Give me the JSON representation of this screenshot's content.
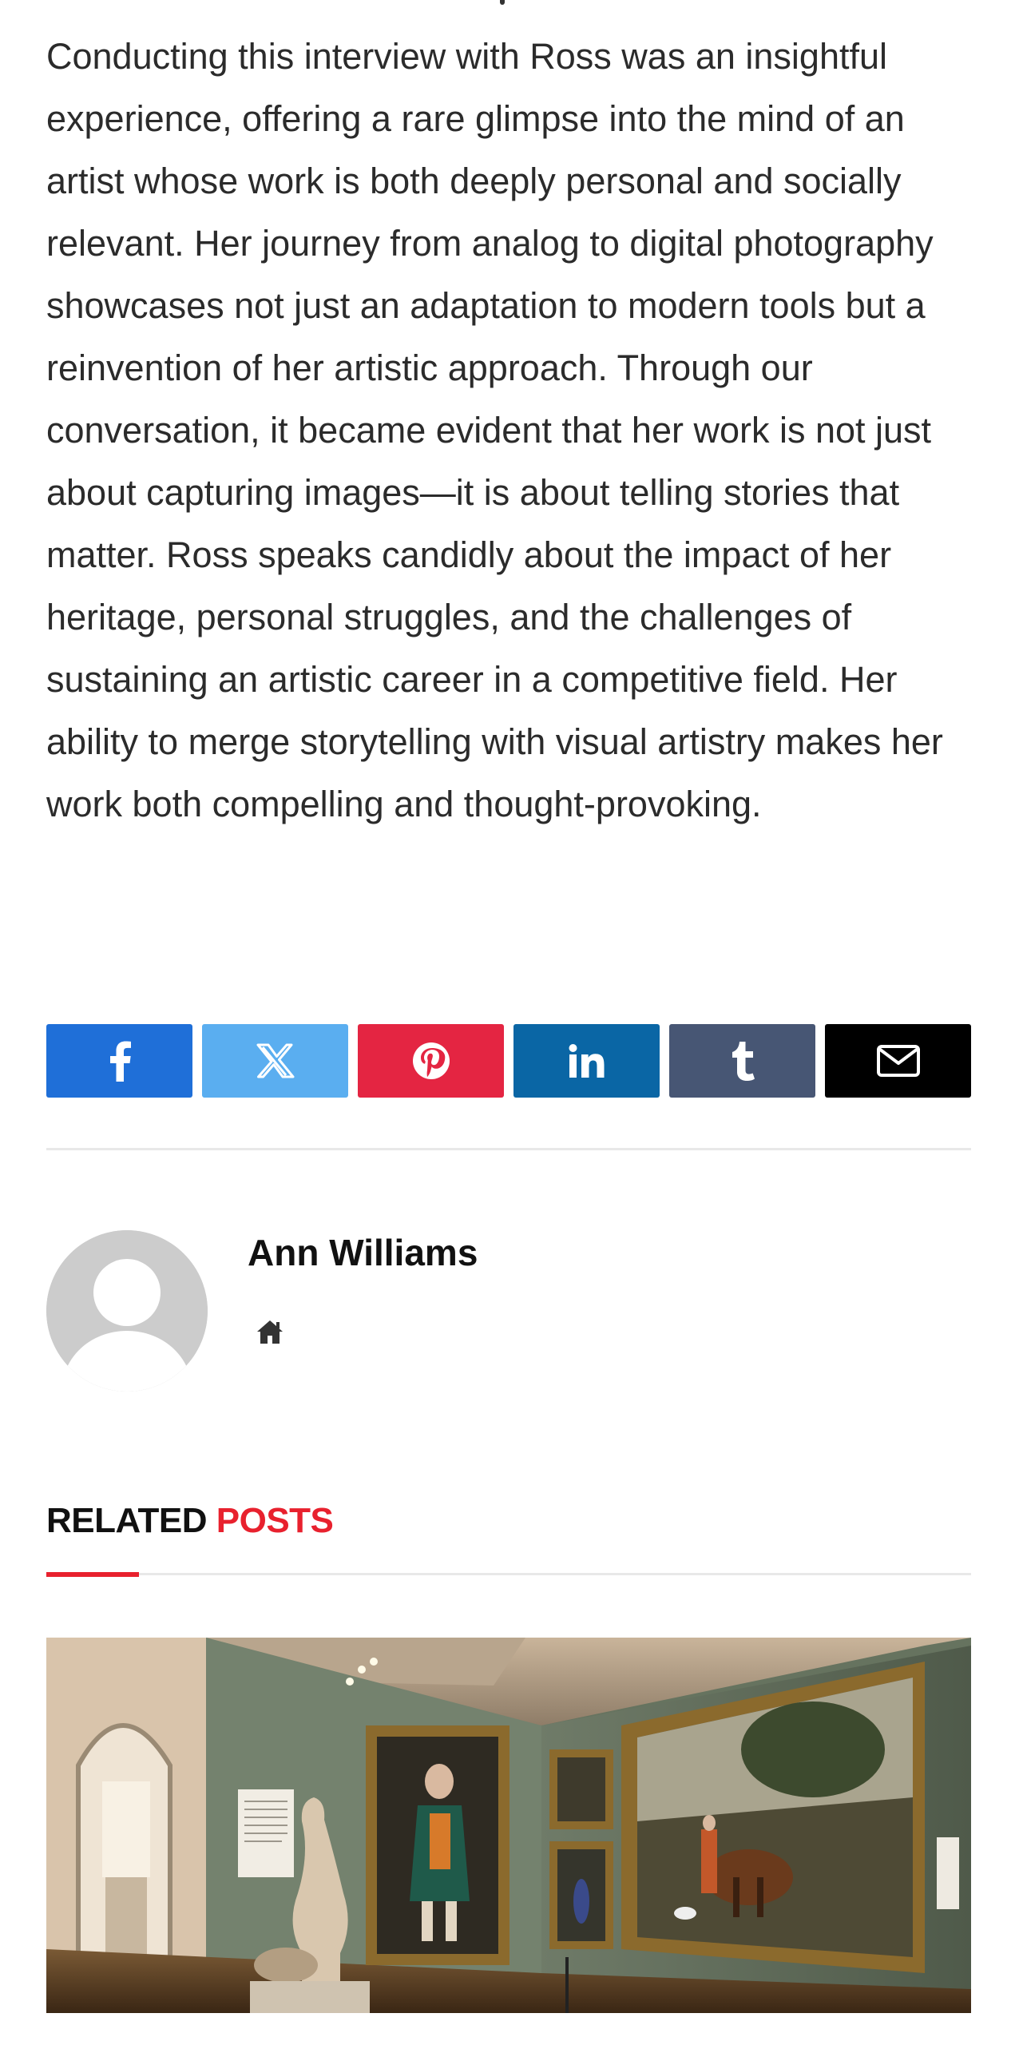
{
  "article": {
    "closing_paragraph": "Conducting this interview with Ross was an insightful experience, offering a rare glimpse into the mind of an artist whose work is both deeply personal and socially relevant. Her journey from analog to digital photography showcases not just an adaptation to modern tools but a reinvention of her artistic approach. Through our conversation, it became evident that her work is not just about capturing images—it is about telling stories that matter. Ross speaks candidly about the impact of her heritage, personal struggles, and the challenges of sustaining an artistic career in a competitive field. Her ability to merge storytelling with visual artistry makes her work both compelling and thought-provoking."
  },
  "share": {
    "buttons": [
      {
        "network": "facebook",
        "icon": "facebook-icon",
        "color": "#1f6fd8"
      },
      {
        "network": "x",
        "icon": "x-icon",
        "color": "#5aaef0"
      },
      {
        "network": "pinterest",
        "icon": "pinterest-icon",
        "color": "#e42542"
      },
      {
        "network": "linkedin",
        "icon": "linkedin-icon",
        "color": "#0a66a5"
      },
      {
        "network": "tumblr",
        "icon": "tumblr-icon",
        "color": "#475674"
      },
      {
        "network": "email",
        "icon": "email-icon",
        "color": "#000000"
      }
    ]
  },
  "author": {
    "name": "Ann Williams",
    "avatar": "default-avatar-icon",
    "website_icon": "home-icon"
  },
  "related": {
    "heading_primary": "RELATED",
    "heading_accent": "POSTS",
    "accent_color": "#e8212e",
    "first_post_image": "museum-gallery-photo"
  }
}
